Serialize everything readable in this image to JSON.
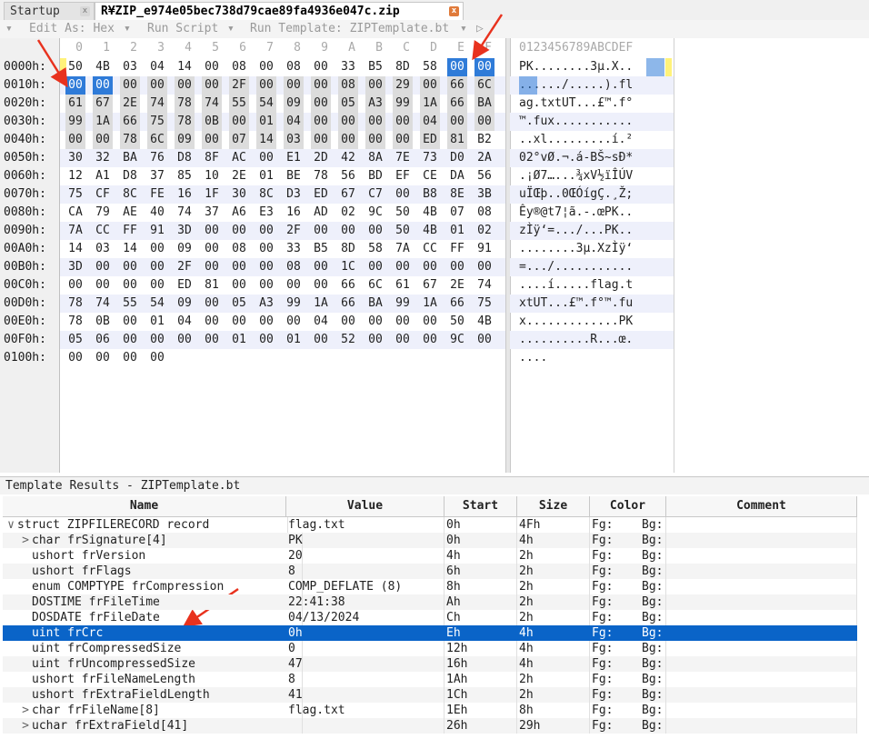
{
  "tabs": [
    {
      "label": "Startup",
      "close": "x"
    },
    {
      "label": "R¥ZIP_e974e05bec738d79cae89fa4936e047c.zip",
      "close": "x"
    }
  ],
  "toolbar": {
    "edit_as": "Edit As: Hex",
    "run_script": "Run Script",
    "run_template": "Run Template: ZIPTemplate.bt",
    "dropdown_glyph": "▾",
    "left_glyph": "▾",
    "play_glyph": "▷"
  },
  "hex": {
    "col_headers": [
      "0",
      "1",
      "2",
      "3",
      "4",
      "5",
      "6",
      "7",
      "8",
      "9",
      "A",
      "B",
      "C",
      "D",
      "E",
      "F"
    ],
    "ascii_header": "0123456789ABCDEF",
    "rows": [
      {
        "addr": "0000h:",
        "bytes": [
          "50",
          "4B",
          "03",
          "04",
          "14",
          "00",
          "08",
          "00",
          "08",
          "00",
          "33",
          "B5",
          "8D",
          "58",
          "00",
          "00"
        ],
        "ascii": "PK........3µ.X.."
      },
      {
        "addr": "0010h:",
        "bytes": [
          "00",
          "00",
          "00",
          "00",
          "00",
          "00",
          "2F",
          "00",
          "00",
          "00",
          "08",
          "00",
          "29",
          "00",
          "66",
          "6C"
        ],
        "ascii": "....../.....).fl"
      },
      {
        "addr": "0020h:",
        "bytes": [
          "61",
          "67",
          "2E",
          "74",
          "78",
          "74",
          "55",
          "54",
          "09",
          "00",
          "05",
          "A3",
          "99",
          "1A",
          "66",
          "BA"
        ],
        "ascii": "ag.txtUT...£™.f°"
      },
      {
        "addr": "0030h:",
        "bytes": [
          "99",
          "1A",
          "66",
          "75",
          "78",
          "0B",
          "00",
          "01",
          "04",
          "00",
          "00",
          "00",
          "00",
          "04",
          "00",
          "00"
        ],
        "ascii": "™.fux..........."
      },
      {
        "addr": "0040h:",
        "bytes": [
          "00",
          "00",
          "78",
          "6C",
          "09",
          "00",
          "07",
          "14",
          "03",
          "00",
          "00",
          "00",
          "00",
          "ED",
          "81",
          "B2"
        ],
        "ascii": "..xl.........í.²"
      },
      {
        "addr": "0050h:",
        "bytes": [
          "30",
          "32",
          "BA",
          "76",
          "D8",
          "8F",
          "AC",
          "00",
          "E1",
          "2D",
          "42",
          "8A",
          "7E",
          "73",
          "D0",
          "2A"
        ],
        "ascii": "02°vØ.¬.á-BŠ~sÐ*"
      },
      {
        "addr": "0060h:",
        "bytes": [
          "12",
          "A1",
          "D8",
          "37",
          "85",
          "10",
          "2E",
          "01",
          "BE",
          "78",
          "56",
          "BD",
          "EF",
          "CE",
          "DA",
          "56"
        ],
        "ascii": ".¡Ø7…...¾xV½ïÎÚV"
      },
      {
        "addr": "0070h:",
        "bytes": [
          "75",
          "CF",
          "8C",
          "FE",
          "16",
          "1F",
          "30",
          "8C",
          "D3",
          "ED",
          "67",
          "C7",
          "00",
          "B8",
          "8E",
          "3B"
        ],
        "ascii": "uÏŒþ..0ŒÓígÇ.¸Ž;"
      },
      {
        "addr": "0080h:",
        "bytes": [
          "CA",
          "79",
          "AE",
          "40",
          "74",
          "37",
          "A6",
          "E3",
          "16",
          "AD",
          "02",
          "9C",
          "50",
          "4B",
          "07",
          "08"
        ],
        "ascii": "Êy®@t7¦ã.-.œPK.."
      },
      {
        "addr": "0090h:",
        "bytes": [
          "7A",
          "CC",
          "FF",
          "91",
          "3D",
          "00",
          "00",
          "00",
          "2F",
          "00",
          "00",
          "00",
          "50",
          "4B",
          "01",
          "02"
        ],
        "ascii": "zÌÿ‘=.../...PK.."
      },
      {
        "addr": "00A0h:",
        "bytes": [
          "14",
          "03",
          "14",
          "00",
          "09",
          "00",
          "08",
          "00",
          "33",
          "B5",
          "8D",
          "58",
          "7A",
          "CC",
          "FF",
          "91"
        ],
        "ascii": "........3µ.XzÌÿ‘"
      },
      {
        "addr": "00B0h:",
        "bytes": [
          "3D",
          "00",
          "00",
          "00",
          "2F",
          "00",
          "00",
          "00",
          "08",
          "00",
          "1C",
          "00",
          "00",
          "00",
          "00",
          "00"
        ],
        "ascii": "=.../..........."
      },
      {
        "addr": "00C0h:",
        "bytes": [
          "00",
          "00",
          "00",
          "00",
          "ED",
          "81",
          "00",
          "00",
          "00",
          "00",
          "66",
          "6C",
          "61",
          "67",
          "2E",
          "74"
        ],
        "ascii": "....í.....flag.t"
      },
      {
        "addr": "00D0h:",
        "bytes": [
          "78",
          "74",
          "55",
          "54",
          "09",
          "00",
          "05",
          "A3",
          "99",
          "1A",
          "66",
          "BA",
          "99",
          "1A",
          "66",
          "75"
        ],
        "ascii": "xtUT...£™.f°™.fu"
      },
      {
        "addr": "00E0h:",
        "bytes": [
          "78",
          "0B",
          "00",
          "01",
          "04",
          "00",
          "00",
          "00",
          "00",
          "04",
          "00",
          "00",
          "00",
          "00",
          "50",
          "4B"
        ],
        "ascii": "x.............PK"
      },
      {
        "addr": "00F0h:",
        "bytes": [
          "05",
          "06",
          "00",
          "00",
          "00",
          "00",
          "01",
          "00",
          "01",
          "00",
          "52",
          "00",
          "00",
          "00",
          "9C",
          "00"
        ],
        "ascii": "..........R...œ."
      },
      {
        "addr": "0100h:",
        "bytes": [
          "00",
          "00",
          "00",
          "00"
        ],
        "ascii": "...."
      }
    ]
  },
  "template": {
    "title": "Template Results - ZIPTemplate.bt",
    "columns": [
      "Name",
      "Value",
      "Start",
      "Size",
      "Color",
      "Comment"
    ],
    "rows": [
      {
        "twisty": "∨",
        "name": "struct ZIPFILERECORD record",
        "value": "flag.txt",
        "start": "0h",
        "size": "4Fh",
        "fg": "Fg:",
        "bg": "Bg:"
      },
      {
        "twisty": ">",
        "name": "char frSignature[4]",
        "value": "PK",
        "start": "0h",
        "size": "4h",
        "fg": "Fg:",
        "bg": "Bg:"
      },
      {
        "twisty": "",
        "name": "ushort frVersion",
        "value": "20",
        "start": "4h",
        "size": "2h",
        "fg": "Fg:",
        "bg": "Bg:"
      },
      {
        "twisty": "",
        "name": "ushort frFlags",
        "value": "8",
        "start": "6h",
        "size": "2h",
        "fg": "Fg:",
        "bg": "Bg:"
      },
      {
        "twisty": "",
        "name": "enum COMPTYPE frCompression",
        "value": "COMP_DEFLATE (8)",
        "start": "8h",
        "size": "2h",
        "fg": "Fg:",
        "bg": "Bg:"
      },
      {
        "twisty": "",
        "name": "DOSTIME frFileTime",
        "value": "22:41:38",
        "start": "Ah",
        "size": "2h",
        "fg": "Fg:",
        "bg": "Bg:"
      },
      {
        "twisty": "",
        "name": "DOSDATE frFileDate",
        "value": "04/13/2024",
        "start": "Ch",
        "size": "2h",
        "fg": "Fg:",
        "bg": "Bg:"
      },
      {
        "twisty": "",
        "name": "uint frCrc",
        "value": "0h",
        "start": "Eh",
        "size": "4h",
        "fg": "Fg:",
        "bg": "Bg:"
      },
      {
        "twisty": "",
        "name": "uint frCompressedSize",
        "value": "0",
        "start": "12h",
        "size": "4h",
        "fg": "Fg:",
        "bg": "Bg:"
      },
      {
        "twisty": "",
        "name": "uint frUncompressedSize",
        "value": "47",
        "start": "16h",
        "size": "4h",
        "fg": "Fg:",
        "bg": "Bg:"
      },
      {
        "twisty": "",
        "name": "ushort frFileNameLength",
        "value": "8",
        "start": "1Ah",
        "size": "2h",
        "fg": "Fg:",
        "bg": "Bg:"
      },
      {
        "twisty": "",
        "name": "ushort frExtraFieldLength",
        "value": "41",
        "start": "1Ch",
        "size": "2h",
        "fg": "Fg:",
        "bg": "Bg:"
      },
      {
        "twisty": ">",
        "name": "char frFileName[8]",
        "value": "flag.txt",
        "start": "1Eh",
        "size": "8h",
        "fg": "Fg:",
        "bg": "Bg:"
      },
      {
        "twisty": ">",
        "name": "uchar frExtraField[41]",
        "value": "",
        "start": "26h",
        "size": "29h",
        "fg": "Fg:",
        "bg": "Bg:"
      }
    ]
  },
  "colors": {
    "selection": "#2f7bd8",
    "row_selection": "#0a64c8",
    "annotation_arrow": "#e8321e",
    "highlight_grey": "#dcdcdc",
    "marker_yellow": "#fff27a"
  },
  "icons": {
    "tab_close": "close-icon",
    "dropdown": "chevron-down-icon",
    "play": "play-icon",
    "expand": "chevron-right-icon",
    "collapse": "chevron-down-icon"
  }
}
